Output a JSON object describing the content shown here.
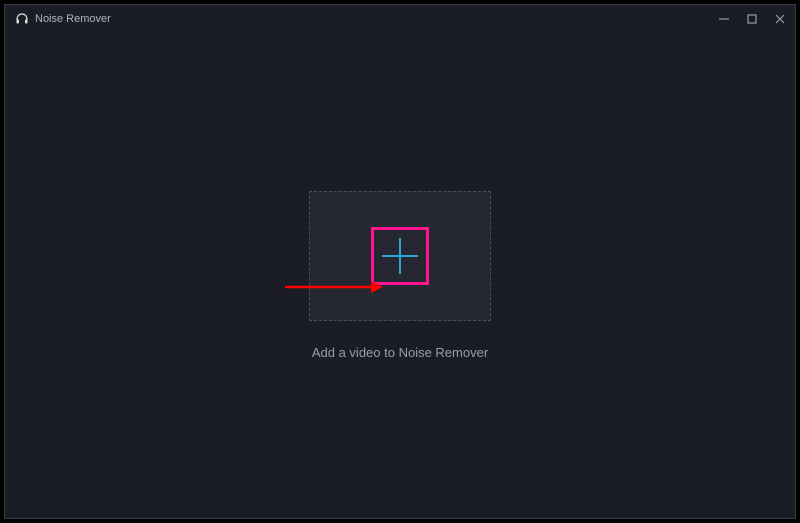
{
  "titlebar": {
    "app_name": "Noise Remover"
  },
  "main": {
    "hint_text": "Add a video to Noise Remover",
    "plus_icon_name": "add-plus-icon",
    "app_icon_name": "headphones-icon"
  },
  "annotation": {
    "arrow_color": "#ff0000",
    "highlight_color": "#ff1493"
  },
  "colors": {
    "background": "#1a1d26",
    "dropzone_bg": "#252831",
    "accent_blue": "#2aa5d8",
    "text_muted": "#9a9da6"
  }
}
